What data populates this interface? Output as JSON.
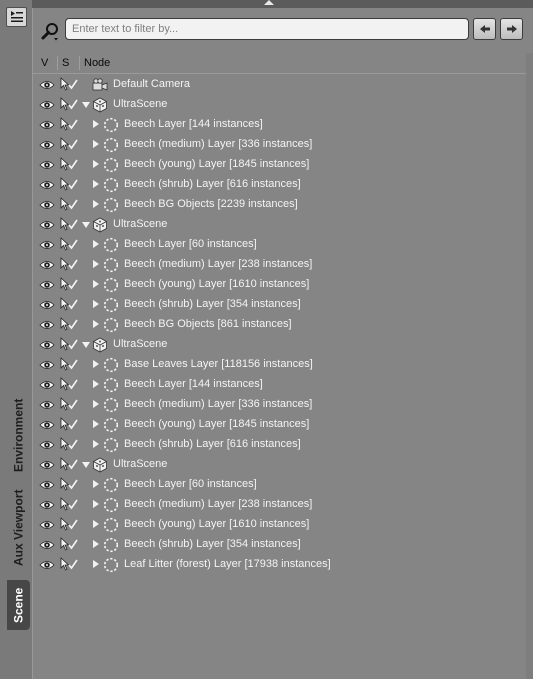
{
  "left_rail": {
    "menu_icon": "panel-menu-icon",
    "tabs": [
      {
        "label": "Environment"
      },
      {
        "label": "Aux Viewport"
      },
      {
        "label": "Scene",
        "active": true
      }
    ]
  },
  "toolbar": {
    "search_icon": "search-icon",
    "filter_placeholder": "Enter text to filter by...",
    "filter_value": "",
    "back_icon": "arrow-left-icon",
    "forward_icon": "arrow-right-icon"
  },
  "columns": {
    "visible": "V",
    "selectable": "S",
    "node": "Node"
  },
  "colors": {
    "panel_bg": "#858585",
    "text": "#f4f4f4",
    "active_tab": "#474747"
  },
  "nodes": [
    {
      "label": "Default Camera",
      "depth": 0,
      "icon": "camera-icon",
      "expander": "none"
    },
    {
      "label": "UltraScene",
      "depth": 0,
      "icon": "scene-cube-icon",
      "expander": "expanded"
    },
    {
      "label": "Beech Layer [144 instances]",
      "depth": 1,
      "icon": "instance-group-icon",
      "expander": "collapsed"
    },
    {
      "label": "Beech (medium) Layer [336 instances]",
      "depth": 1,
      "icon": "instance-group-icon",
      "expander": "collapsed"
    },
    {
      "label": "Beech (young) Layer [1845 instances]",
      "depth": 1,
      "icon": "instance-group-icon",
      "expander": "collapsed"
    },
    {
      "label": "Beech (shrub) Layer [616 instances]",
      "depth": 1,
      "icon": "instance-group-icon",
      "expander": "collapsed"
    },
    {
      "label": "Beech BG Objects [2239 instances]",
      "depth": 1,
      "icon": "instance-group-icon",
      "expander": "collapsed"
    },
    {
      "label": "UltraScene",
      "depth": 0,
      "icon": "scene-cube-icon",
      "expander": "expanded"
    },
    {
      "label": "Beech Layer [60 instances]",
      "depth": 1,
      "icon": "instance-group-icon",
      "expander": "collapsed"
    },
    {
      "label": "Beech (medium) Layer [238 instances]",
      "depth": 1,
      "icon": "instance-group-icon",
      "expander": "collapsed"
    },
    {
      "label": "Beech (young) Layer [1610 instances]",
      "depth": 1,
      "icon": "instance-group-icon",
      "expander": "collapsed"
    },
    {
      "label": "Beech (shrub) Layer [354 instances]",
      "depth": 1,
      "icon": "instance-group-icon",
      "expander": "collapsed"
    },
    {
      "label": "Beech BG Objects [861 instances]",
      "depth": 1,
      "icon": "instance-group-icon",
      "expander": "collapsed"
    },
    {
      "label": "UltraScene",
      "depth": 0,
      "icon": "scene-cube-icon",
      "expander": "expanded"
    },
    {
      "label": "Base Leaves Layer [118156 instances]",
      "depth": 1,
      "icon": "instance-group-icon",
      "expander": "collapsed"
    },
    {
      "label": "Beech Layer [144 instances]",
      "depth": 1,
      "icon": "instance-group-icon",
      "expander": "collapsed"
    },
    {
      "label": "Beech (medium) Layer [336 instances]",
      "depth": 1,
      "icon": "instance-group-icon",
      "expander": "collapsed"
    },
    {
      "label": "Beech (young) Layer [1845 instances]",
      "depth": 1,
      "icon": "instance-group-icon",
      "expander": "collapsed"
    },
    {
      "label": "Beech (shrub) Layer [616 instances]",
      "depth": 1,
      "icon": "instance-group-icon",
      "expander": "collapsed"
    },
    {
      "label": "UltraScene",
      "depth": 0,
      "icon": "scene-cube-icon",
      "expander": "expanded"
    },
    {
      "label": "Beech Layer [60 instances]",
      "depth": 1,
      "icon": "instance-group-icon",
      "expander": "collapsed"
    },
    {
      "label": "Beech (medium) Layer [238 instances]",
      "depth": 1,
      "icon": "instance-group-icon",
      "expander": "collapsed"
    },
    {
      "label": "Beech (young) Layer [1610 instances]",
      "depth": 1,
      "icon": "instance-group-icon",
      "expander": "collapsed"
    },
    {
      "label": "Beech (shrub) Layer [354 instances]",
      "depth": 1,
      "icon": "instance-group-icon",
      "expander": "collapsed"
    },
    {
      "label": "Leaf Litter (forest) Layer [17938 instances]",
      "depth": 1,
      "icon": "instance-group-icon",
      "expander": "collapsed"
    }
  ]
}
